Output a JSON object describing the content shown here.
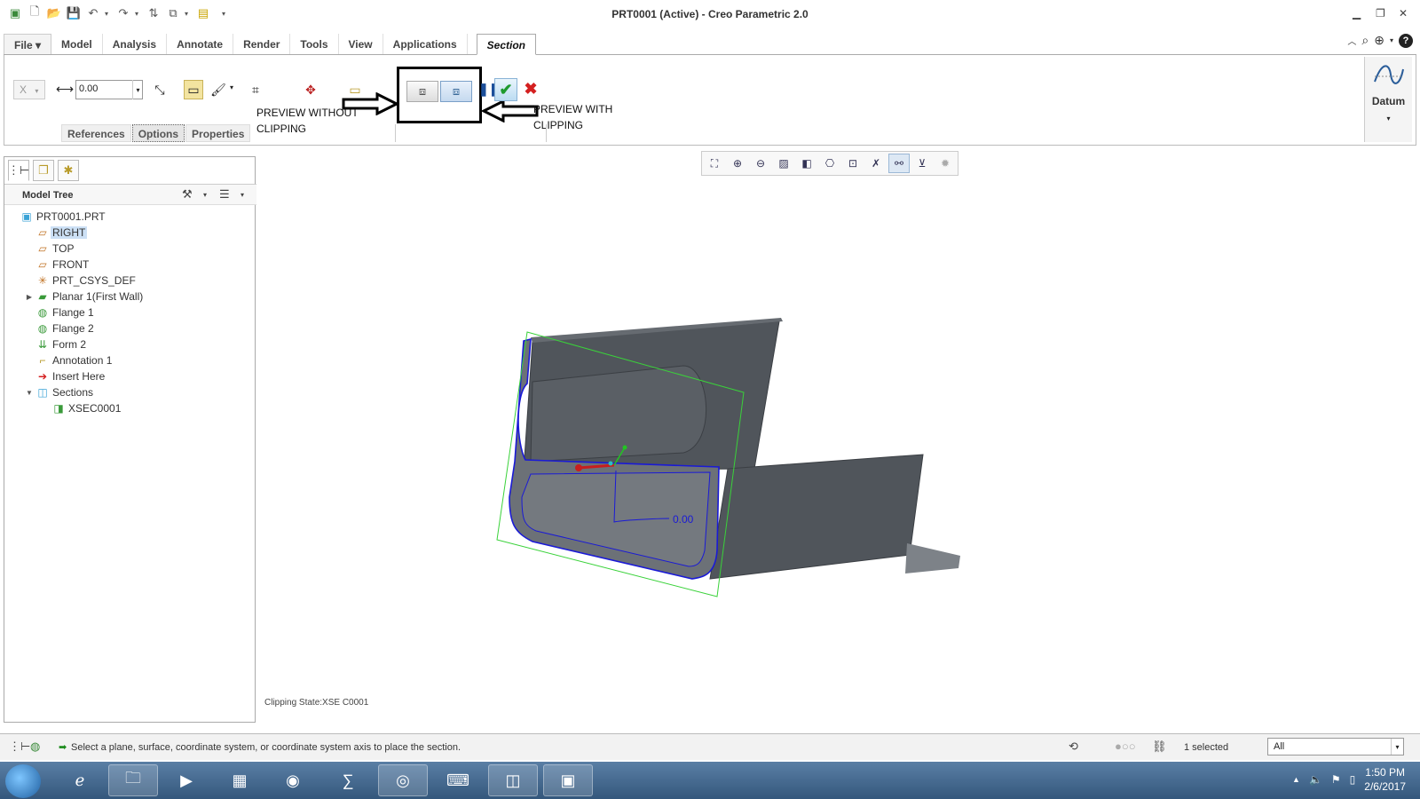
{
  "window": {
    "title": "PRT0001 (Active) - Creo Parametric 2.0"
  },
  "ribbon_tabs": [
    {
      "label": "File ▾",
      "active": false,
      "name": "tab-file"
    },
    {
      "label": "Model",
      "active": false,
      "name": "tab-model"
    },
    {
      "label": "Analysis",
      "active": false,
      "name": "tab-analysis"
    },
    {
      "label": "Annotate",
      "active": false,
      "name": "tab-annotate"
    },
    {
      "label": "Render",
      "active": false,
      "name": "tab-render"
    },
    {
      "label": "Tools",
      "active": false,
      "name": "tab-tools"
    },
    {
      "label": "View",
      "active": false,
      "name": "tab-view"
    },
    {
      "label": "Applications",
      "active": false,
      "name": "tab-applications"
    },
    {
      "label": "Section",
      "active": true,
      "name": "tab-section"
    }
  ],
  "section_ribbon": {
    "axis_combo": "X",
    "offset_value": "0.00",
    "annotation_left": "PREVIEW WITHOUT\nCLIPPING",
    "annotation_right": "PREVIEW WITH\nCLIPPING",
    "subtabs": [
      "References",
      "Options",
      "Properties"
    ],
    "selected_subtab": "Options",
    "datum_label": "Datum"
  },
  "model_tree": {
    "title": "Model Tree",
    "nodes": [
      {
        "label": "PRT0001.PRT",
        "icon": "part-icon",
        "level": 0,
        "expand": ""
      },
      {
        "label": "RIGHT",
        "icon": "datum-plane-icon",
        "level": 1,
        "expand": "",
        "highlight": true
      },
      {
        "label": "TOP",
        "icon": "datum-plane-icon",
        "level": 1,
        "expand": ""
      },
      {
        "label": "FRONT",
        "icon": "datum-plane-icon",
        "level": 1,
        "expand": ""
      },
      {
        "label": "PRT_CSYS_DEF",
        "icon": "csys-icon",
        "level": 1,
        "expand": ""
      },
      {
        "label": "Planar 1(First Wall)",
        "icon": "planar-wall-icon",
        "level": 1,
        "expand": "▶"
      },
      {
        "label": "Flange 1",
        "icon": "flange-icon",
        "level": 1,
        "expand": ""
      },
      {
        "label": "Flange 2",
        "icon": "flange-icon",
        "level": 1,
        "expand": ""
      },
      {
        "label": "Form 2",
        "icon": "form-icon",
        "level": 1,
        "expand": ""
      },
      {
        "label": "Annotation 1",
        "icon": "annotation-icon",
        "level": 1,
        "expand": ""
      },
      {
        "label": "Insert Here",
        "icon": "insert-arrow-icon",
        "level": 1,
        "expand": ""
      },
      {
        "label": "Sections",
        "icon": "sections-folder-icon",
        "level": 1,
        "expand": "▼"
      },
      {
        "label": "XSEC0001",
        "icon": "xsec-icon",
        "level": 2,
        "expand": ""
      }
    ]
  },
  "graphics": {
    "dimension_label": "0.00",
    "clipping_state": "Clipping State:XSE C0001"
  },
  "status": {
    "message": "Select a plane, surface, coordinate system, or coordinate system axis to place the section.",
    "selected_count": "1 selected",
    "filter": "All"
  },
  "taskbar": {
    "time": "1:50 PM",
    "date": "2/6/2017"
  },
  "colors": {
    "section_outline": "#1a1ad6",
    "plane_outline": "#3ad23a",
    "model_gray": "#50555b",
    "accept_green": "#1e9a2e",
    "cancel_red": "#d42020"
  }
}
